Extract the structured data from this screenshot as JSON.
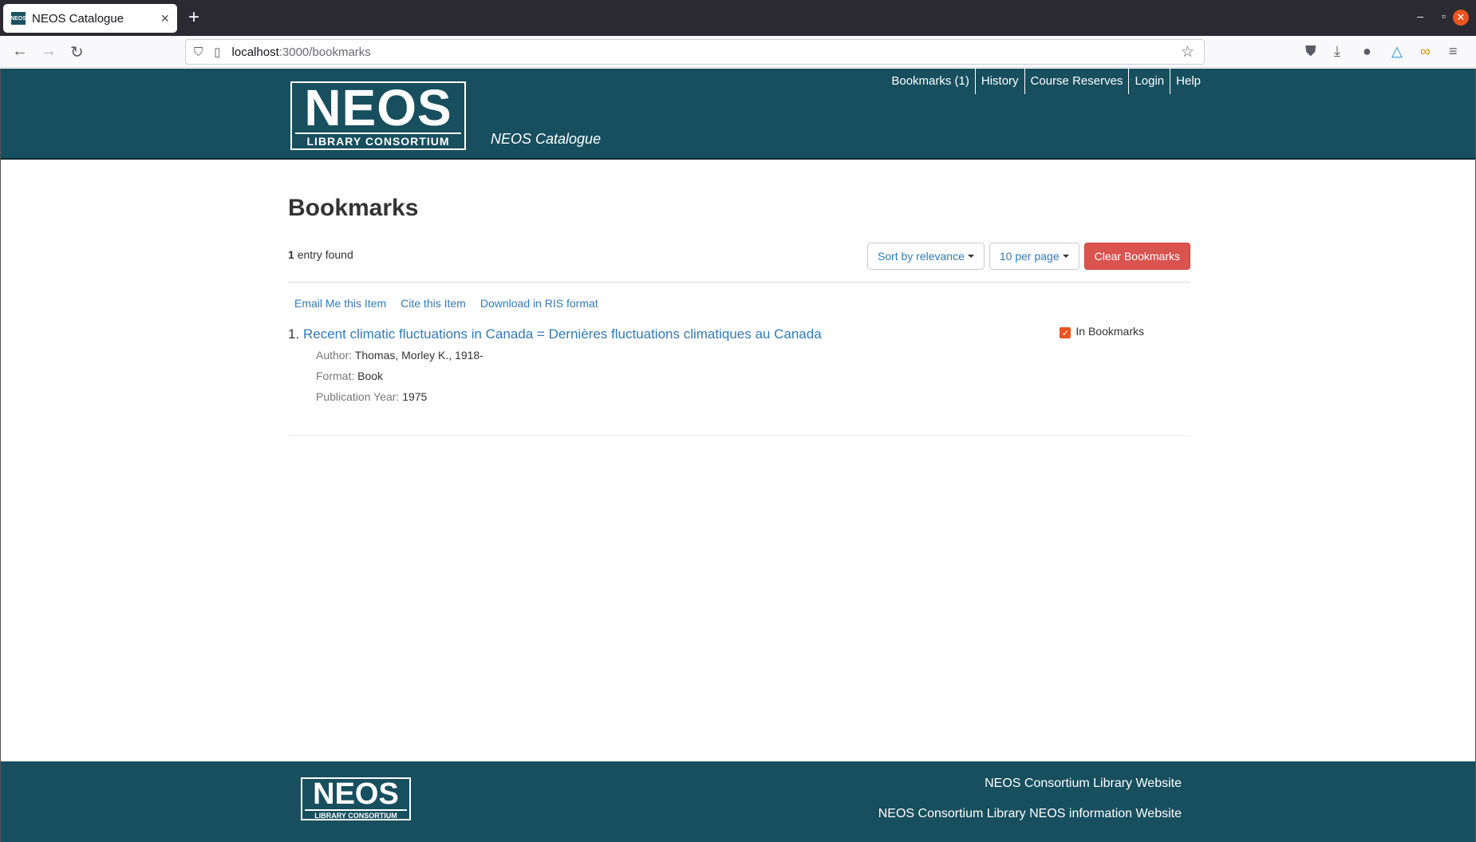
{
  "browser": {
    "tab_title": "NEOS Catalogue",
    "url_host": "localhost",
    "url_path": ":3000/bookmarks"
  },
  "header": {
    "logo_text": "NEOS",
    "logo_subtext": "LIBRARY CONSORTIUM",
    "catalogue_name": "NEOS Catalogue",
    "nav": [
      "Bookmarks (1)",
      "History",
      "Course Reserves",
      "Login",
      "Help"
    ]
  },
  "main": {
    "title": "Bookmarks",
    "entry_count": "1",
    "entry_label": "entry found",
    "sort_label": "Sort by relevance",
    "per_page_label": "10 per page",
    "clear_label": "Clear Bookmarks",
    "tools": [
      "Email Me this Item",
      "Cite this Item",
      "Download in RIS format"
    ],
    "document": {
      "number": "1.",
      "title": "Recent climatic fluctuations in Canada = Dernières fluctuations climatiques au Canada",
      "bookmark_label": "In Bookmarks",
      "bookmarked": true,
      "author_label": "Author:",
      "author": "Thomas, Morley K., 1918-",
      "format_label": "Format:",
      "format": "Book",
      "year_label": "Publication Year:",
      "year": "1975"
    }
  },
  "footer": {
    "logo_text": "NEOS",
    "logo_subtext": "LIBRARY CONSORTIUM",
    "links": [
      "NEOS Consortium Library Website",
      "NEOS Consortium Library NEOS information Website"
    ]
  },
  "colors": {
    "header_bg": "#174f5e",
    "link": "#337ab7",
    "danger": "#d9534f",
    "checkbox": "#e95420"
  }
}
